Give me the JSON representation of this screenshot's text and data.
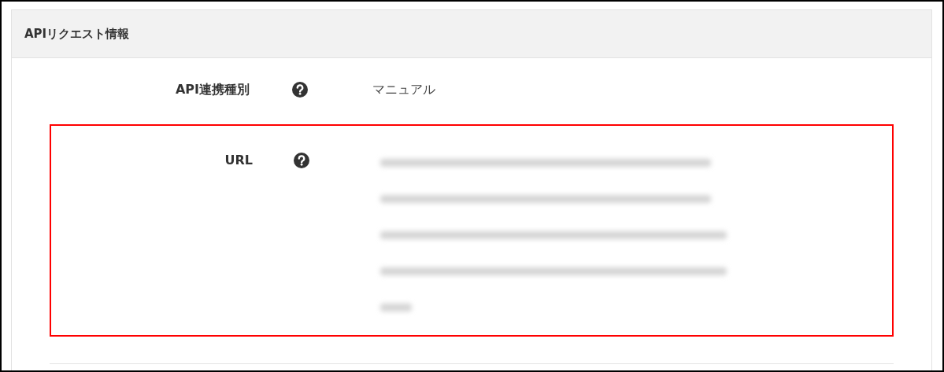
{
  "panel": {
    "title": "APIリクエスト情報"
  },
  "rows": [
    {
      "label": "API連携種別",
      "value": "マニュアル",
      "kind": "text",
      "highlighted": false
    },
    {
      "label": "URL",
      "kind": "blurred",
      "highlighted": true
    }
  ]
}
